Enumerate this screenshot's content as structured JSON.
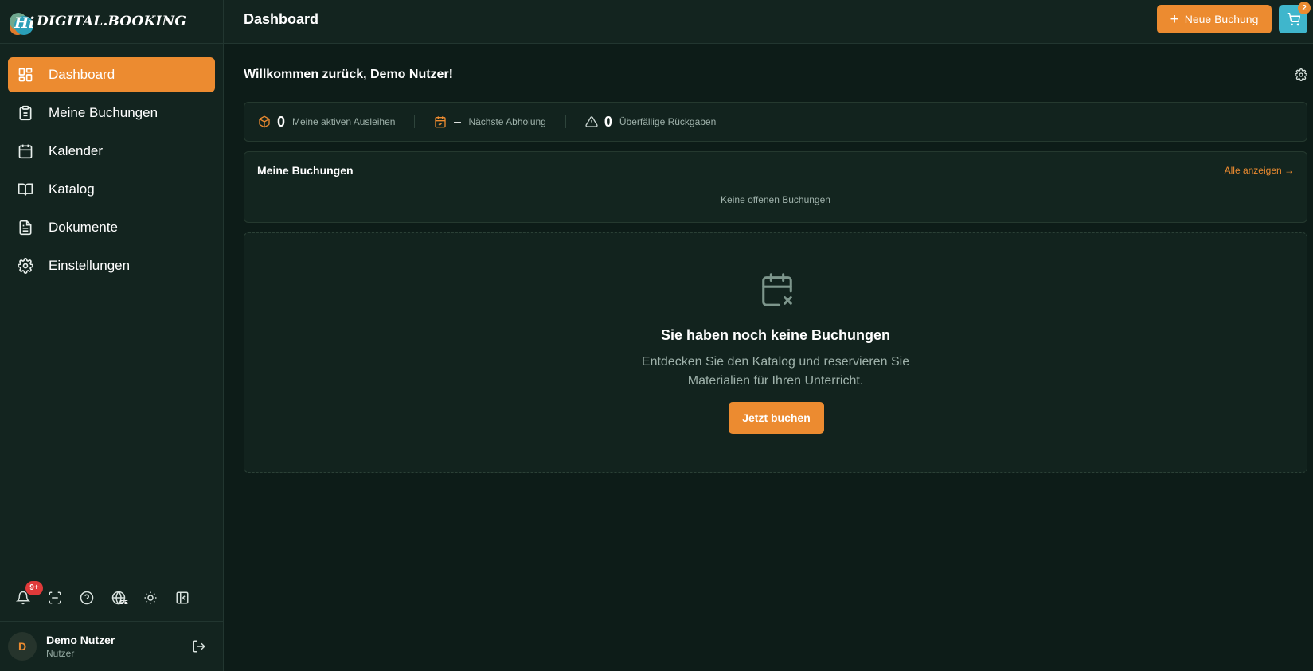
{
  "app": {
    "logo_mark": "Hi",
    "logo_text": "DIGITAL.BOOKING"
  },
  "sidebar": {
    "items": [
      {
        "label": "Dashboard",
        "icon": "dashboard-icon",
        "active": true
      },
      {
        "label": "Meine Buchungen",
        "icon": "clipboard-icon"
      },
      {
        "label": "Kalender",
        "icon": "calendar-icon"
      },
      {
        "label": "Katalog",
        "icon": "book-icon"
      },
      {
        "label": "Dokumente",
        "icon": "document-icon"
      },
      {
        "label": "Einstellungen",
        "icon": "gear-icon"
      }
    ],
    "tools": {
      "notifications_badge": "9+",
      "language": "DE"
    },
    "user": {
      "initial": "D",
      "name": "Demo Nutzer",
      "role": "Nutzer"
    }
  },
  "header": {
    "title": "Dashboard",
    "new_booking_label": "Neue Buchung",
    "cart_count": "2"
  },
  "main": {
    "welcome": "Willkommen zurück, Demo Nutzer!",
    "stats": [
      {
        "value": "0",
        "label": "Meine aktiven Ausleihen",
        "icon": "box-icon"
      },
      {
        "value": "–",
        "label": "Nächste Abholung",
        "icon": "calendar-check-icon"
      },
      {
        "value": "0",
        "label": "Überfällige Rückgaben",
        "icon": "warning-icon"
      }
    ],
    "bookings": {
      "title": "Meine Buchungen",
      "link": "Alle anzeigen →",
      "empty": "Keine offenen Buchungen"
    },
    "empty_state": {
      "title": "Sie haben noch keine Buchungen",
      "text_line1": "Entdecken Sie den Katalog und reservieren Sie",
      "text_line2": "Materialien für Ihren Unterricht.",
      "button": "Jetzt buchen"
    }
  },
  "colors": {
    "accent": "#ec8b30",
    "cart": "#3fb6cc",
    "background": "#0d1c18",
    "sidebar": "#13241f",
    "danger": "#e03a3a"
  }
}
